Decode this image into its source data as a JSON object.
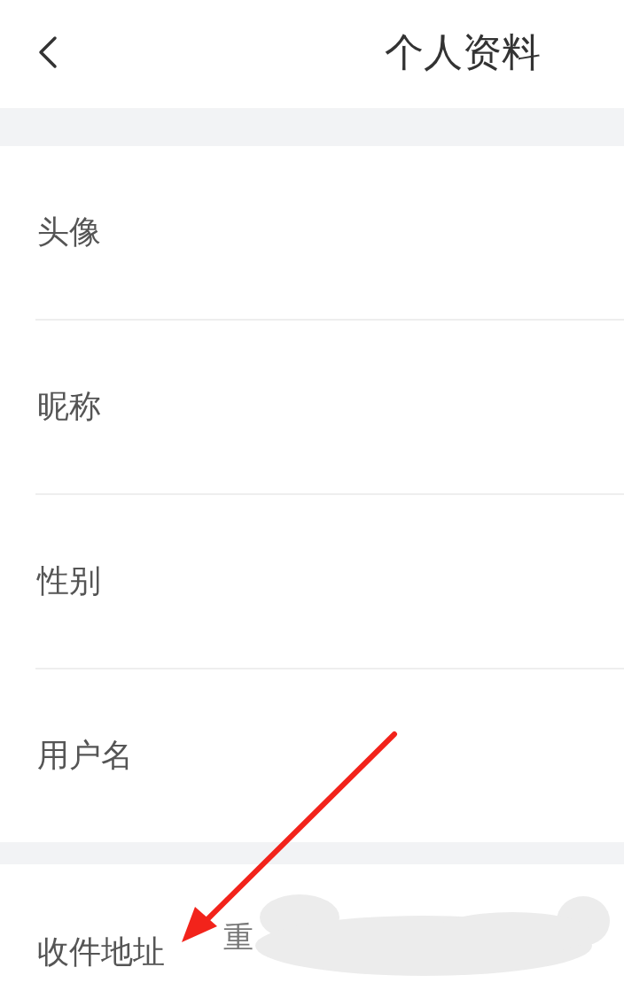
{
  "header": {
    "title": "个人资料"
  },
  "sections": [
    {
      "rows": [
        {
          "label": "头像"
        },
        {
          "label": "昵称"
        },
        {
          "label": "性别"
        },
        {
          "label": "用户名"
        }
      ]
    },
    {
      "rows": [
        {
          "label": "收件地址",
          "value": "重",
          "redacted": true,
          "pointed": true
        }
      ]
    }
  ]
}
